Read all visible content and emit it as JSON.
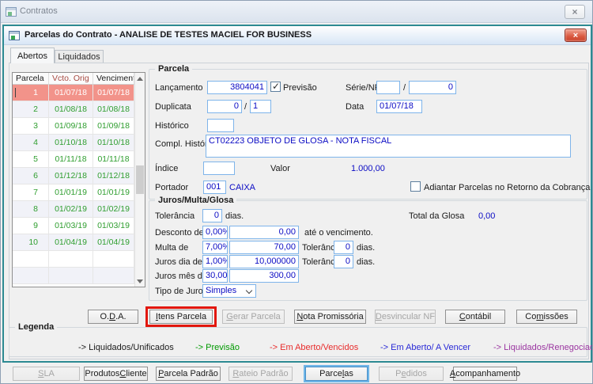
{
  "colors": {
    "selected_row_bg": "#f2938a",
    "grid_green_text": "#2f9e2f",
    "field_value_blue": "#0b0bc4",
    "vcto_header_red": "#a84a42",
    "inner_border_teal": "#2d8a92",
    "highlight_red": "#e2170d"
  },
  "outer_window": {
    "title": "Contratos",
    "close_glyph": "×"
  },
  "inner_window": {
    "title": "Parcelas do Contrato - ANALISE DE TESTES MACIEL FOR BUSINESS",
    "close_glyph": "×"
  },
  "tabs": {
    "abertos": "Abertos",
    "liquidados": "Liquidados"
  },
  "grid": {
    "columns": {
      "parcela": "Parcela",
      "vcto_orig": "Vcto. Orig",
      "vencimento": "Vencimento"
    },
    "rows": [
      {
        "num": "1",
        "vcto": "01/07/18",
        "venc": "01/07/18"
      },
      {
        "num": "2",
        "vcto": "01/08/18",
        "venc": "01/08/18"
      },
      {
        "num": "3",
        "vcto": "01/09/18",
        "venc": "01/09/18"
      },
      {
        "num": "4",
        "vcto": "01/10/18",
        "venc": "01/10/18"
      },
      {
        "num": "5",
        "vcto": "01/11/18",
        "venc": "01/11/18"
      },
      {
        "num": "6",
        "vcto": "01/12/18",
        "venc": "01/12/18"
      },
      {
        "num": "7",
        "vcto": "01/01/19",
        "venc": "01/01/19"
      },
      {
        "num": "8",
        "vcto": "01/02/19",
        "venc": "01/02/19"
      },
      {
        "num": "9",
        "vcto": "01/03/19",
        "venc": "01/03/19"
      },
      {
        "num": "10",
        "vcto": "01/04/19",
        "venc": "01/04/19"
      }
    ]
  },
  "parcela": {
    "title": "Parcela",
    "lancamento_label": "Lançamento",
    "lancamento_value": "3804041",
    "previsao_label": "Previsão",
    "previsao_checked": true,
    "serie_nf_label": "Série/NF",
    "serie_value": "",
    "serie_sep": "/",
    "nf_value": "0",
    "duplicata_label": "Duplicata",
    "duplicata_value": "0",
    "duplicata_sep": "/",
    "duplicata_seq": "1",
    "data_label": "Data",
    "data_value": "01/07/18",
    "historico_label": "Histórico",
    "historico_value": "",
    "compl_historico_label": "Compl. Histórico",
    "compl_historico_value": "CT02223 OBJETO DE GLOSA - NOTA FISCAL",
    "indice_label": "Índice",
    "indice_value": "",
    "valor_label": "Valor",
    "valor_value": "1.000,00",
    "portador_label": "Portador",
    "portador_value": "001",
    "portador_name": "CAIXA",
    "adiantar_label": "Adiantar Parcelas no Retorno da Cobrança",
    "adiantar_checked": false
  },
  "juros": {
    "title": "Juros/Multa/Glosa",
    "tolerancia_label": "Tolerância",
    "tolerancia_value": "0",
    "dias_label": "dias.",
    "total_glosa_label": "Total da Glosa",
    "total_glosa_value": "0,00",
    "desconto_label": "Desconto de",
    "desconto_pct": "0,00%",
    "desconto_val": "0,00",
    "ate_venc_label": "até o vencimento.",
    "multa_label": "Multa de",
    "multa_pct": "7,00%",
    "multa_val": "70,00",
    "multa_tol_label": "Tolerância",
    "multa_tol_value": "0",
    "multa_dias_label": "dias.",
    "juros_dia_label": "Juros dia de",
    "juros_dia_pct": "1,00%",
    "juros_dia_val": "10,000000",
    "jdia_tol_label": "Tolerância",
    "jdia_tol_value": "0",
    "jdia_dias_label": "dias.",
    "juros_mes_label": "Juros mês de",
    "juros_mes_pct": "30,00%",
    "juros_mes_val": "300,00",
    "tipo_juros_label": "Tipo de Juros",
    "tipo_juros_value": "Simples"
  },
  "action_buttons": [
    {
      "label": "O.D.A.",
      "mnemonic": 2,
      "enabled": true,
      "highlighted": false
    },
    {
      "label": "Itens Parcela",
      "mnemonic": 0,
      "enabled": true,
      "highlighted": true
    },
    {
      "label": "Gerar Parcela",
      "mnemonic": 0,
      "enabled": false,
      "highlighted": false
    },
    {
      "label": "Nota Promissória",
      "mnemonic": 0,
      "enabled": true,
      "highlighted": false
    },
    {
      "label": "Desvincular NF",
      "mnemonic": 0,
      "enabled": false,
      "highlighted": false
    },
    {
      "label": "Contábil",
      "mnemonic": 0,
      "enabled": true,
      "highlighted": false
    },
    {
      "label": "Comissões",
      "mnemonic": 2,
      "enabled": true,
      "highlighted": false
    }
  ],
  "legend": {
    "title": "Legenda",
    "items": [
      {
        "label": "-> Liquidados/Unificados",
        "color": "#1a1a1a"
      },
      {
        "label": "-> Previsão",
        "color": "#009900"
      },
      {
        "label": "-> Em Aberto/Vencidos",
        "color": "#e82c2c"
      },
      {
        "label": "-> Em Aberto/ A Vencer",
        "color": "#2929d6"
      },
      {
        "label": "-> Liquidados/Renegociados",
        "color": "#9a35a0"
      }
    ]
  },
  "bottom_buttons": [
    {
      "label": "SLA",
      "mnemonic": 0,
      "enabled": false,
      "focused": false
    },
    {
      "label": "Produtos Cliente",
      "mnemonic": 9,
      "enabled": true,
      "focused": false
    },
    {
      "label": "Parcela Padrão",
      "mnemonic": 0,
      "enabled": true,
      "focused": false
    },
    {
      "label": "Rateio Padrão",
      "mnemonic": 0,
      "enabled": false,
      "focused": false
    },
    {
      "label": "Parcelas",
      "mnemonic": 5,
      "enabled": true,
      "focused": true
    },
    {
      "label": "Pedidos",
      "mnemonic": 1,
      "enabled": false,
      "focused": false
    },
    {
      "label": "Acompanhamento",
      "mnemonic": 0,
      "enabled": true,
      "focused": false
    }
  ]
}
